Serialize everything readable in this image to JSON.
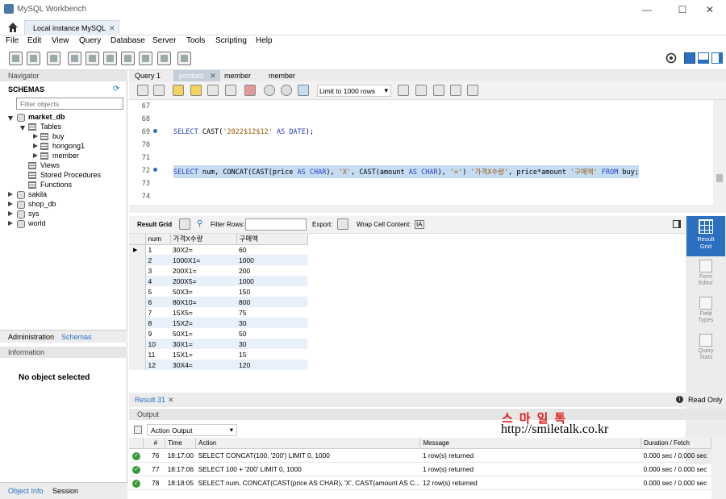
{
  "window": {
    "title": "MySQL Workbench",
    "min": "—",
    "max": "☐",
    "close": "✕"
  },
  "connection_tab": {
    "label": "Local instance MySQL",
    "close": "✕"
  },
  "menu": [
    "File",
    "Edit",
    "View",
    "Query",
    "Database",
    "Server",
    "Tools",
    "Scripting",
    "Help"
  ],
  "navigator": {
    "header": "Navigator",
    "schemas_title": "SCHEMAS",
    "filter_placeholder": "Filter objects",
    "tree": {
      "db": "market_db",
      "tables_label": "Tables",
      "tables": [
        "buy",
        "hongong1",
        "member"
      ],
      "views": "Views",
      "procs": "Stored Procedures",
      "funcs": "Functions",
      "others": [
        "sakila",
        "shop_db",
        "sys",
        "world"
      ]
    },
    "tabs": {
      "admin": "Administration",
      "schemas": "Schemas"
    },
    "info_header": "Information",
    "no_object": "No object selected",
    "bottom_tabs": {
      "object_info": "Object Info",
      "session": "Session"
    }
  },
  "query_tabs": [
    "Query 1",
    "product",
    "member",
    "member"
  ],
  "limit": "Limit to 1000 rows",
  "editor": {
    "lines": [
      {
        "n": "67",
        "text": ""
      },
      {
        "n": "68",
        "text": ""
      },
      {
        "n": "69",
        "parts": [
          [
            "kw",
            "SELECT "
          ],
          [
            "",
            "CAST("
          ],
          [
            "str",
            "'2022$12$12'"
          ],
          [
            "kw",
            " AS DATE"
          ],
          [
            "",
            ");"
          ]
        ]
      },
      {
        "n": "70",
        "text": ""
      },
      {
        "n": "71",
        "text": ""
      },
      {
        "n": "72",
        "parts": [
          [
            "kw",
            "SELECT "
          ],
          [
            "",
            "num, CONCAT(CAST(price "
          ],
          [
            "kw",
            "AS CHAR"
          ],
          [
            "",
            "), "
          ],
          [
            "str",
            "'X'"
          ],
          [
            "",
            ", CAST(amount "
          ],
          [
            "kw",
            "AS CHAR"
          ],
          [
            "",
            "), "
          ],
          [
            "str",
            "'='"
          ],
          [
            "",
            ") "
          ],
          [
            "str",
            "'가격X수량'"
          ],
          [
            "",
            ", price*amount "
          ],
          [
            "str",
            "'구매액'"
          ],
          [
            "kw",
            " FROM "
          ],
          [
            "",
            "buy;"
          ]
        ]
      },
      {
        "n": "73",
        "text": ""
      },
      {
        "n": "74",
        "text": ""
      }
    ]
  },
  "result_toolbar": {
    "result_grid": "Result Grid",
    "filter_rows": "Filter Rows:",
    "export": "Export:",
    "wrap": "Wrap Cell Content:",
    "wrap_icon": "IA"
  },
  "grid": {
    "columns": [
      "num",
      "가격X수량",
      "구매액"
    ],
    "rows": [
      [
        "1",
        "30X2=",
        "60"
      ],
      [
        "2",
        "1000X1=",
        "1000"
      ],
      [
        "3",
        "200X1=",
        "200"
      ],
      [
        "4",
        "200X5=",
        "1000"
      ],
      [
        "5",
        "50X3=",
        "150"
      ],
      [
        "6",
        "80X10=",
        "800"
      ],
      [
        "7",
        "15X5=",
        "75"
      ],
      [
        "8",
        "15X2=",
        "30"
      ],
      [
        "9",
        "50X1=",
        "50"
      ],
      [
        "10",
        "30X1=",
        "30"
      ],
      [
        "11",
        "15X1=",
        "15"
      ],
      [
        "12",
        "30X4=",
        "120"
      ]
    ]
  },
  "side_panel": [
    {
      "label1": "Result",
      "label2": "Grid"
    },
    {
      "label1": "Form",
      "label2": "Editor"
    },
    {
      "label1": "Field",
      "label2": "Types"
    },
    {
      "label1": "Query",
      "label2": "Stats"
    }
  ],
  "result_tab": {
    "label": "Result 31",
    "close": "✕",
    "status": "Read Only",
    "info": "i"
  },
  "output": {
    "header": "Output",
    "selector": "Action Output",
    "columns": [
      "#",
      "Time",
      "Action",
      "Message",
      "Duration / Fetch"
    ],
    "rows": [
      [
        "76",
        "18:17:00",
        "SELECT CONCAT(100, '200') LIMIT 0, 1000",
        "1 row(s) returned",
        "0.000 sec / 0.000 sec"
      ],
      [
        "77",
        "18:17:06",
        "SELECT 100 + '200' LIMIT 0, 1000",
        "1 row(s) returned",
        "0.000 sec / 0.000 sec"
      ],
      [
        "78",
        "18:18:05",
        "SELECT num, CONCAT(CAST(price AS CHAR), 'X', CAST(amount AS C...",
        "12 row(s) returned",
        "0.000 sec / 0.000 sec"
      ]
    ]
  },
  "watermark": {
    "line1": "스마일톡",
    "line2": "http://smiletalk.co.kr"
  }
}
